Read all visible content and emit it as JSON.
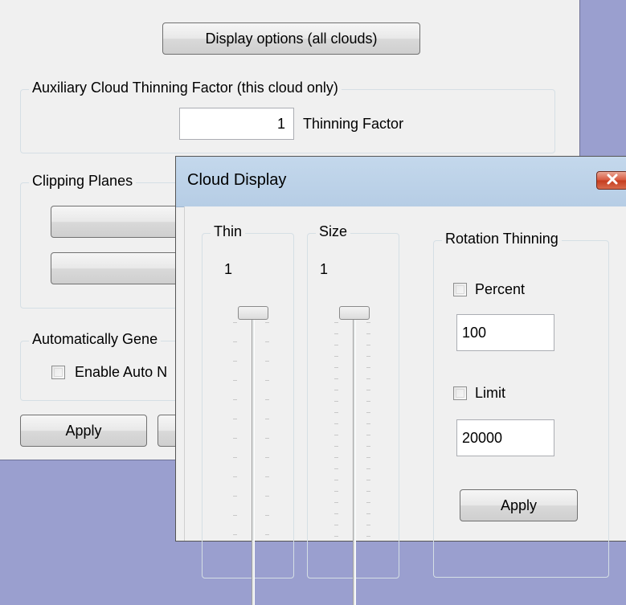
{
  "main": {
    "display_options_label": "Display options (all clouds)",
    "aux_group_title": "Auxiliary Cloud Thinning Factor (this cloud only)",
    "thinning_value": "1",
    "thinning_label": "Thinning Factor",
    "clipping_group_title": "Clipping Planes",
    "auto_group_title": "Automatically Gene",
    "enable_auto_label": "Enable Auto N",
    "apply_label": "Apply"
  },
  "dialog": {
    "title": "Cloud Display",
    "close_icon": "close-icon",
    "thin_title": "Thin",
    "thin_value": "1",
    "size_title": "Size",
    "size_value": "1",
    "rotation_title": "Rotation Thinning",
    "percent_label": "Percent",
    "percent_value": "100",
    "limit_label": "Limit",
    "limit_value": "20000",
    "apply_label": "Apply"
  },
  "colors": {
    "desktop": "#9a9fcf",
    "titlebar": "#b9d1ea",
    "close_button": "#c94a2e"
  }
}
